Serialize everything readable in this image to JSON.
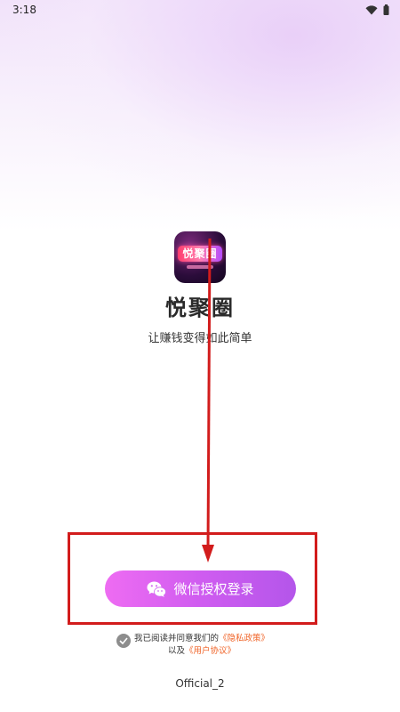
{
  "status_bar": {
    "time": "3:18",
    "icons": [
      "wifi-icon",
      "battery-icon"
    ]
  },
  "app": {
    "name": "悦聚圈",
    "slogan": "让赚钱变得如此简单",
    "icon_text": "悦聚圈"
  },
  "login": {
    "button_label": "微信授权登录",
    "button_icon": "wechat-icon"
  },
  "agreement": {
    "prefix": "我已阅读并同意我们的",
    "privacy_link": "《隐私政策》",
    "and": "以及",
    "terms_link": "《用户协议》",
    "checked": true
  },
  "footer": {
    "version": "Official_2"
  },
  "annotations": {
    "highlight_color": "#d21c1c",
    "arrow_color": "#d21c1c"
  },
  "colors": {
    "button_gradient_start": "#ee6cf2",
    "button_gradient_end": "#b456ea",
    "link": "#f06428"
  }
}
